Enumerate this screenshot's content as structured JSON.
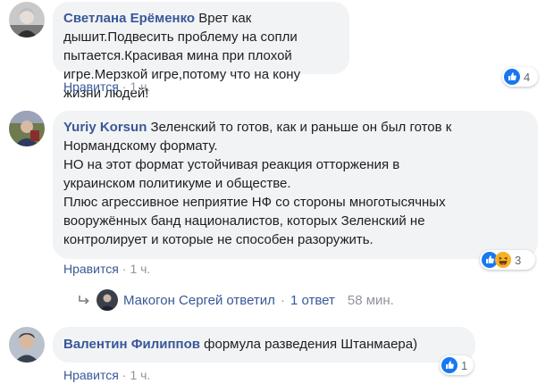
{
  "comments": [
    {
      "author": "Светлана Ерёменко",
      "text": "Врет как дышит.Подвесить проблему на сопли пытается.Красивая мина при плохой игре.Мерзкой игре,потому что на кону жизни людей!",
      "like_label": "Нравится",
      "time": "1 ч.",
      "reaction_count": "4",
      "reactions": [
        "like-icon"
      ]
    },
    {
      "author": "Yuriy Korsun",
      "text": "Зеленский то готов, как и раньше он был готов к Нормандскому формату.",
      "text_lines": [
        "НО на этот формат устойчивая реакция отторжения в",
        "украинском политикуме и обществе.",
        "Плюс агрессивное неприятие НФ со стороны многотысячных",
        "вооружённых банд националистов, которых Зеленский не",
        "контролирует и которые не способен разоружить."
      ],
      "like_label": "Нравится",
      "time": "1 ч.",
      "reaction_count": "3",
      "reactions": [
        "like-icon",
        "haha-icon"
      ],
      "reply_summary": {
        "author": "Макогон Сергей",
        "replied": "ответил",
        "replies": "1 ответ",
        "time": "58 мин."
      }
    },
    {
      "author": "Валентин Филиппов",
      "text": "формула разведения Штанмаера)",
      "like_label": "Нравится",
      "time": "1 ч.",
      "reaction_count": "1",
      "reactions": [
        "like-icon"
      ]
    }
  ],
  "separator": "·",
  "colors": {
    "link": "#385898",
    "bubble": "#f2f3f5",
    "meta": "#90949c",
    "like_blue": "#1877f2",
    "haha_yellow": "#f7b125"
  }
}
